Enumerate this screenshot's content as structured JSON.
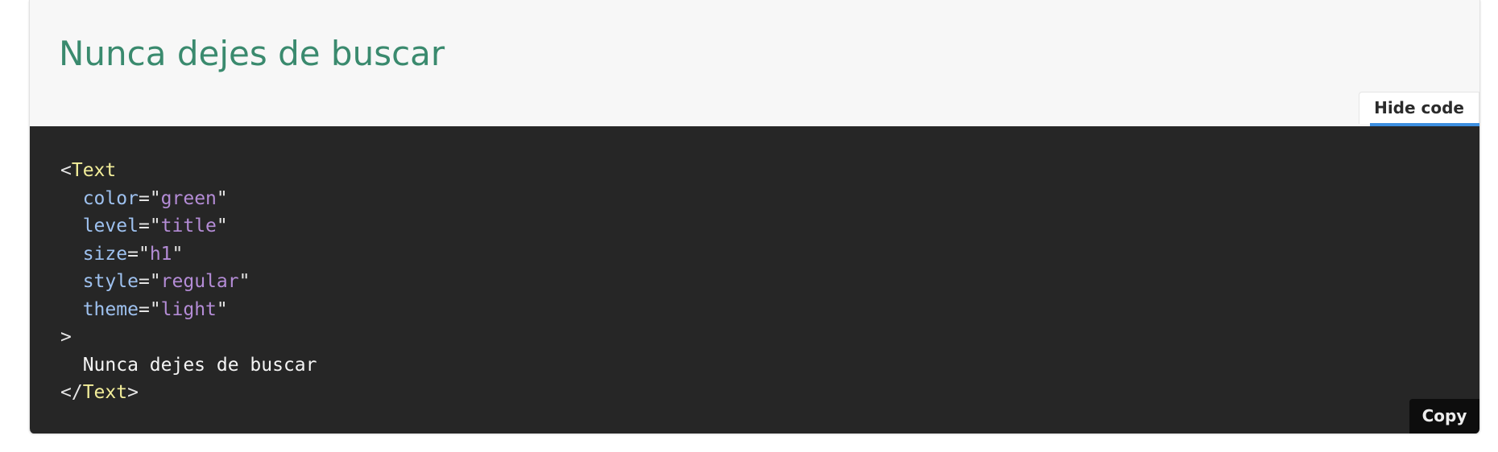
{
  "preview": {
    "title": "Nunca dejes de buscar"
  },
  "toolbar": {
    "hide_code_label": "Hide code",
    "copy_label": "Copy"
  },
  "code": {
    "open_lt": "<",
    "tag_name": "Text",
    "attrs": [
      {
        "name": "color",
        "value": "green"
      },
      {
        "name": "level",
        "value": "title"
      },
      {
        "name": "size",
        "value": "h1"
      },
      {
        "name": "style",
        "value": "regular"
      },
      {
        "name": "theme",
        "value": "light"
      }
    ],
    "eq": "=",
    "quote": "\"",
    "gt": ">",
    "content": "Nunca dejes de buscar",
    "close_lt": "</",
    "close_tag_name": "Text",
    "close_gt": ">"
  },
  "colors": {
    "title_green": "#3a8a6e",
    "code_background": "#262626",
    "preview_background": "#f7f7f7",
    "tab_underline_blue": "#3d8fe0",
    "tag_color": "#f3ee9a",
    "attr_color": "#9ec1ef",
    "value_color": "#b48cd6"
  }
}
